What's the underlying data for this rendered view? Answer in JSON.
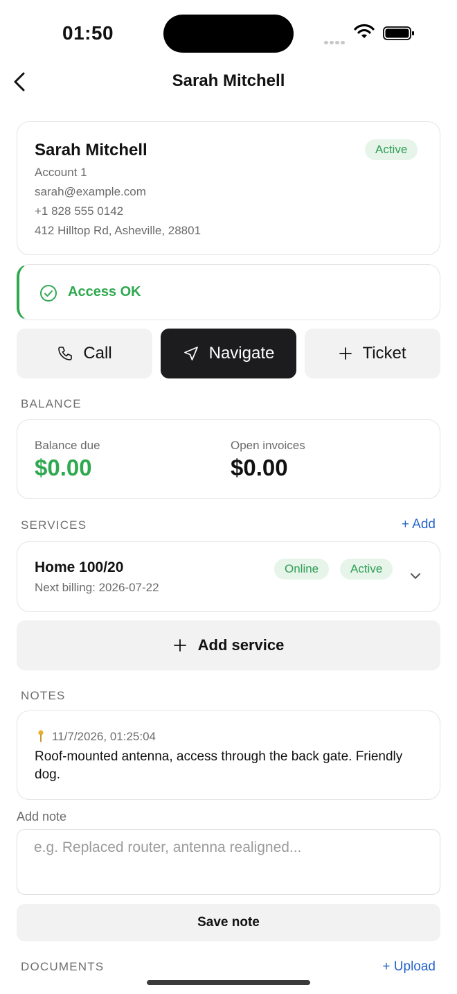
{
  "status_bar": {
    "time": "01:50"
  },
  "nav": {
    "title": "Sarah Mitchell"
  },
  "customer": {
    "name": "Sarah Mitchell",
    "status": "Active",
    "account": "Account 1",
    "email": "sarah@example.com",
    "phone": "+1 828 555 0142",
    "address": "412 Hilltop Rd, Asheville, 28801"
  },
  "access": {
    "label": "Access OK"
  },
  "actions": {
    "call": "Call",
    "navigate": "Navigate",
    "ticket": "Ticket"
  },
  "balance": {
    "section_label": "BALANCE",
    "due_label": "Balance due",
    "due_value": "$0.00",
    "invoices_label": "Open invoices",
    "invoices_value": "$0.00"
  },
  "services": {
    "section_label": "SERVICES",
    "add_link": "+ Add",
    "items": [
      {
        "name": "Home 100/20",
        "billing": "Next billing: 2026-07-22",
        "connection": "Online",
        "status": "Active"
      }
    ],
    "add_service_label": "Add service"
  },
  "notes": {
    "section_label": "NOTES",
    "items": [
      {
        "timestamp": "11/7/2026, 01:25:04",
        "text": "Roof-mounted antenna, access through the back gate. Friendly dog."
      }
    ],
    "add_note_label": "Add note",
    "add_note_placeholder": "e.g. Replaced router, antenna realigned...",
    "save_label": "Save note"
  },
  "documents": {
    "section_label": "DOCUMENTS",
    "upload_link": "+ Upload"
  },
  "colors": {
    "accent_green": "#2fa84f",
    "link_blue": "#2563c9",
    "primary_dark": "#1c1c1e"
  }
}
